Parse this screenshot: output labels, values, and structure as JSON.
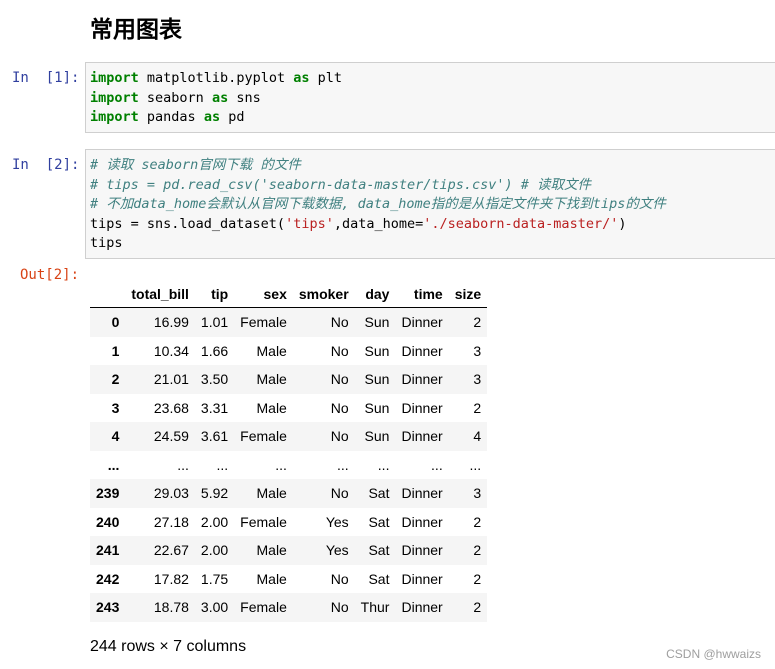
{
  "heading": "常用图表",
  "cells": [
    {
      "prompt": "In  [1]:",
      "lines": [
        [
          {
            "c": "kw",
            "t": "import"
          },
          {
            "c": "plain",
            "t": " matplotlib.pyplot "
          },
          {
            "c": "kw",
            "t": "as"
          },
          {
            "c": "plain",
            "t": " plt"
          }
        ],
        [
          {
            "c": "kw",
            "t": "import"
          },
          {
            "c": "plain",
            "t": " seaborn "
          },
          {
            "c": "kw",
            "t": "as"
          },
          {
            "c": "plain",
            "t": " sns"
          }
        ],
        [
          {
            "c": "kw",
            "t": "import"
          },
          {
            "c": "plain",
            "t": " pandas "
          },
          {
            "c": "kw",
            "t": "as"
          },
          {
            "c": "plain",
            "t": " pd"
          }
        ]
      ]
    },
    {
      "prompt": "In  [2]:",
      "lines": [
        [
          {
            "c": "cm",
            "t": "# 读取 seaborn官网下载 的文件"
          }
        ],
        [
          {
            "c": "cm",
            "t": "# tips = pd.read_csv('seaborn-data-master/tips.csv') # 读取文件"
          }
        ],
        [
          {
            "c": "cm",
            "t": "# 不加data_home会默认从官网下载数据, data_home指的是从指定文件夹下找到tips的文件"
          }
        ],
        [
          {
            "c": "plain",
            "t": "tips = sns.load_dataset("
          },
          {
            "c": "str",
            "t": "'tips'"
          },
          {
            "c": "plain",
            "t": ",data_home="
          },
          {
            "c": "str",
            "t": "'./seaborn-data-master/'"
          },
          {
            "c": "plain",
            "t": ")"
          }
        ],
        [
          {
            "c": "plain",
            "t": "tips"
          }
        ]
      ]
    }
  ],
  "output_prompt": "Out[2]:",
  "table": {
    "columns": [
      "",
      "total_bill",
      "tip",
      "sex",
      "smoker",
      "day",
      "time",
      "size"
    ],
    "rows": [
      [
        "0",
        "16.99",
        "1.01",
        "Female",
        "No",
        "Sun",
        "Dinner",
        "2"
      ],
      [
        "1",
        "10.34",
        "1.66",
        "Male",
        "No",
        "Sun",
        "Dinner",
        "3"
      ],
      [
        "2",
        "21.01",
        "3.50",
        "Male",
        "No",
        "Sun",
        "Dinner",
        "3"
      ],
      [
        "3",
        "23.68",
        "3.31",
        "Male",
        "No",
        "Sun",
        "Dinner",
        "2"
      ],
      [
        "4",
        "24.59",
        "3.61",
        "Female",
        "No",
        "Sun",
        "Dinner",
        "4"
      ],
      [
        "...",
        "...",
        "...",
        "...",
        "...",
        "...",
        "...",
        "..."
      ],
      [
        "239",
        "29.03",
        "5.92",
        "Male",
        "No",
        "Sat",
        "Dinner",
        "3"
      ],
      [
        "240",
        "27.18",
        "2.00",
        "Female",
        "Yes",
        "Sat",
        "Dinner",
        "2"
      ],
      [
        "241",
        "22.67",
        "2.00",
        "Male",
        "Yes",
        "Sat",
        "Dinner",
        "2"
      ],
      [
        "242",
        "17.82",
        "1.75",
        "Male",
        "No",
        "Sat",
        "Dinner",
        "2"
      ],
      [
        "243",
        "18.78",
        "3.00",
        "Female",
        "No",
        "Thur",
        "Dinner",
        "2"
      ]
    ]
  },
  "summary": "244 rows × 7 columns",
  "watermark": "CSDN @hwwaizs"
}
